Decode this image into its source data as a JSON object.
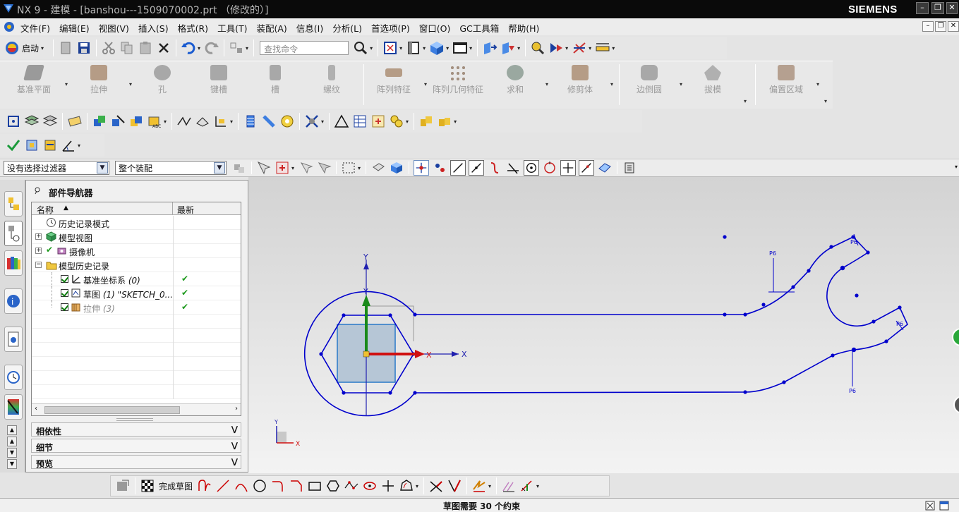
{
  "window": {
    "title": "NX 9 - 建模 - [banshou---1509070002.prt （修改的）]",
    "brand": "SIEMENS",
    "controls": [
      "–",
      "❐",
      "✕"
    ]
  },
  "menubar": {
    "items": [
      "文件(F)",
      "编辑(E)",
      "视图(V)",
      "插入(S)",
      "格式(R)",
      "工具(T)",
      "装配(A)",
      "信息(I)",
      "分析(L)",
      "首选项(P)",
      "窗口(O)",
      "GC工具箱",
      "帮助(H)"
    ]
  },
  "toolbar": {
    "start_label": "启动",
    "search_placeholder": "查找命令"
  },
  "ribbon": {
    "commands": [
      {
        "label": "基准平面",
        "icon": "datum-plane-icon"
      },
      {
        "label": "拉伸",
        "icon": "extrude-icon"
      },
      {
        "label": "孔",
        "icon": "hole-icon"
      },
      {
        "label": "键槽",
        "icon": "slot-icon"
      },
      {
        "label": "槽",
        "icon": "groove-icon"
      },
      {
        "label": "螺纹",
        "icon": "thread-icon"
      },
      {
        "label": "阵列特征",
        "icon": "pattern-feature-icon"
      },
      {
        "label": "阵列几何特征",
        "icon": "pattern-geometry-icon"
      },
      {
        "label": "求和",
        "icon": "unite-icon"
      },
      {
        "label": "修剪体",
        "icon": "trim-body-icon"
      },
      {
        "label": "边倒圆",
        "icon": "edge-blend-icon"
      },
      {
        "label": "拔模",
        "icon": "draft-icon"
      },
      {
        "label": "偏置区域",
        "icon": "offset-region-icon"
      }
    ]
  },
  "filterbar": {
    "selection_filter": "没有选择过滤器",
    "assembly_scope": "整个装配"
  },
  "navigator": {
    "title": "部件导航器",
    "columns": [
      "名称",
      "最新"
    ],
    "rows": [
      {
        "label": "历史记录模式",
        "latest": ""
      },
      {
        "label": "模型视图",
        "latest": ""
      },
      {
        "label": "摄像机",
        "latest": ""
      },
      {
        "label": "模型历史记录",
        "latest": ""
      },
      {
        "label": "基准坐标系",
        "suffix": "(0)",
        "latest": "✔"
      },
      {
        "label": "草图",
        "suffix": "(1) \"SKETCH_0...",
        "latest": "✔"
      },
      {
        "label": "拉伸",
        "suffix": "(3)",
        "latest": "✔"
      }
    ],
    "panels": [
      "相依性",
      "细节",
      "预览"
    ]
  },
  "canvas": {
    "axis_x": "X",
    "axis_y": "Y",
    "dimension_tag": "P6",
    "sketch_color": "#0000cc",
    "z_axis_color": "#1a8a1a",
    "x_axis_color": "#d01010"
  },
  "bottom_toolbar": {
    "finish_sketch": "完成草图"
  },
  "status": {
    "message": "草图需要 30 个约束"
  }
}
